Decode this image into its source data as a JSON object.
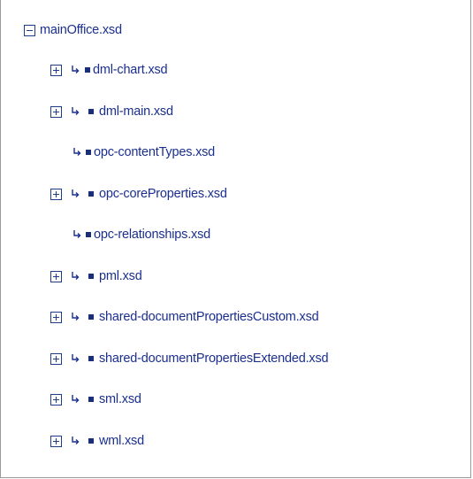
{
  "root": {
    "label": "mainOffice.xsd",
    "toggle": "collapse"
  },
  "children": [
    {
      "label": "dml-chart.xsd",
      "expandable": true
    },
    {
      "label": "dml-main.xsd",
      "expandable": true
    },
    {
      "label": "opc-contentTypes.xsd",
      "expandable": false
    },
    {
      "label": "opc-coreProperties.xsd",
      "expandable": true
    },
    {
      "label": "opc-relationships.xsd",
      "expandable": false
    },
    {
      "label": "pml.xsd",
      "expandable": true
    },
    {
      "label": "shared-documentPropertiesCustom.xsd",
      "expandable": true
    },
    {
      "label": "shared-documentPropertiesExtended.xsd",
      "expandable": true
    },
    {
      "label": "sml.xsd",
      "expandable": true
    },
    {
      "label": "wml.xsd",
      "expandable": true
    }
  ],
  "colors": {
    "link": "#1a2f8f",
    "toggle_border": "#1c3c8c",
    "panel_border": "#9a9a9a"
  },
  "icons": {
    "expand": "plus-box-icon",
    "collapse": "minus-box-icon",
    "import": "import-arrow-icon",
    "element": "square-bullet-icon"
  }
}
